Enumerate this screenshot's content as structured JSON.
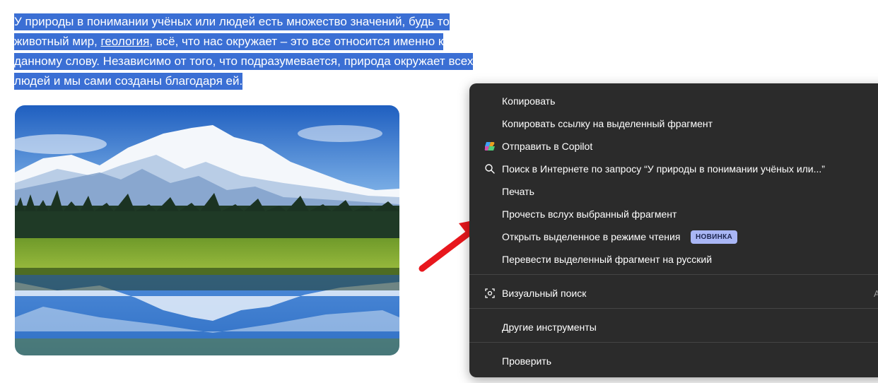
{
  "article": {
    "line1": "У природы в понимании учёных или людей есть множество значений, будь то",
    "line2_before": "животный мир, ",
    "line2_link": "геология",
    "line2_after": ", всё, что нас окружает – это все относится именно к",
    "line3": "данному слову. Независимо от того, что подразумевается, природа окружает всех",
    "line4": "людей и мы сами созданы благодаря ей.",
    "selection_color": "#3b6fd4"
  },
  "image": {
    "subject": "mountain-lake-landscape"
  },
  "arrow": {
    "color": "#e8171d"
  },
  "context_menu": {
    "items": [
      {
        "label": "Копировать"
      },
      {
        "label": "Копировать ссылку на выделенный фрагмент"
      },
      {
        "label": "Отправить в Copilot",
        "icon": "copilot-icon"
      },
      {
        "label": "Поиск в Интернете по запросу “У природы в понимании учёных или...”",
        "icon": "search-icon"
      },
      {
        "label": "Печать"
      },
      {
        "label": "Прочесть вслух выбранный фрагмент"
      },
      {
        "label": "Открыть выделенное в режиме чтения",
        "badge": "НОВИНКА"
      },
      {
        "label": "Перевести выделенный фрагмент на русский"
      },
      {
        "label": "Визуальный поиск",
        "icon": "visual-search-icon",
        "shortcut": "A"
      },
      {
        "label": "Другие инструменты"
      },
      {
        "label": "Проверить"
      }
    ]
  }
}
